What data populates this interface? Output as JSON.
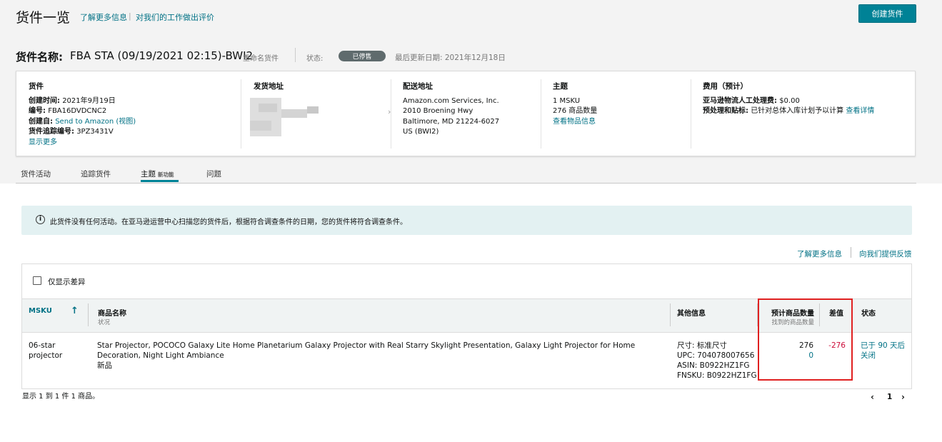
{
  "header": {
    "title": "货件一览",
    "learn_more": "了解更多信息",
    "separator": "|",
    "feedback": "对我们的工作做出评价",
    "create_button": "创建货件"
  },
  "shipment": {
    "name_label": "货件名称:",
    "name": "FBA STA (09/19/2021 02:15)-BWI2",
    "rename": "重命名货件",
    "status_label": "状态:",
    "status": "已停售",
    "updated": "最后更新日期:  2021年12月18日"
  },
  "card": {
    "shipment": {
      "heading": "货件",
      "created_label": "创建时间:",
      "created": "2021年9月19日",
      "id_label": "编号:",
      "id": "FBA16DVDCNC2",
      "created_from_label": "创建自:",
      "created_from": "Send to Amazon",
      "view": "(视图)",
      "tracking_label": "货件追踪编号:",
      "tracking": "3PZ3431V",
      "show_more": "显示更多"
    },
    "ship_from": {
      "heading": "发货地址"
    },
    "ship_to": {
      "heading": "配送地址",
      "lines": [
        "Amazon.com Services, Inc.",
        "2010 Broening Hwy",
        "Baltimore, MD 21224-6027",
        "US (BWI2)"
      ]
    },
    "contents": {
      "heading": "主题",
      "msku": "1 MSKU",
      "units": "276 商品数量",
      "view_items": "查看物品信息"
    },
    "fees": {
      "heading": "费用（预计）",
      "labor_label": "亚马逊物流人工处理费:",
      "labor": "$0.00",
      "prep_label": "预处理和贴标:",
      "prep": "已针对总体入库计划予以计算",
      "details": "查看详情"
    }
  },
  "tabs": [
    {
      "label": "货件活动"
    },
    {
      "label": "追踪货件"
    },
    {
      "label": "主题",
      "badge": "新功能"
    },
    {
      "label": "问题"
    }
  ],
  "alert": {
    "icon": "i",
    "text": "此货件没有任何活动。在亚马逊运营中心扫描您的货件后，根据符合调查条件的日期，您的货件将符合调查条件。"
  },
  "links": {
    "learn_more": "了解更多信息",
    "feedback": "向我们提供反馈"
  },
  "filter": {
    "label": "仅显示差异"
  },
  "table": {
    "columns": {
      "msku": "MSKU",
      "product": "商品名称",
      "product_sub": "状况",
      "info": "其他信息",
      "expected": "预计商品数量",
      "expected_sub": "找到的商品数量",
      "diff": "差值",
      "status": "状态"
    },
    "rows": [
      {
        "msku_line1": "06-star",
        "msku_line2": "projector",
        "title": "Star Projector, POCOCO Galaxy Lite Home Planetarium Galaxy Projector with Real Starry Skylight Presentation, Galaxy Light Projector for Home Decoration, Night Light Ambiance",
        "condition": "新品",
        "size": "尺寸: 标准尺寸",
        "upc": "UPC: 704078007656",
        "asin": "ASIN: B0922HZ1FG",
        "fnsku": "FNSKU: B0922HZ1FG",
        "expected": "276",
        "found": "0",
        "diff": "-276",
        "status_line1": "已于 90 天后",
        "status_line2": "关闭"
      }
    ]
  },
  "footer": {
    "showing": "显示 1 到 1 件 1 商品。",
    "page": "1"
  },
  "icons": {
    "sort": "arrow-up-icon",
    "pager_prev": "chevron-left-icon",
    "pager_next": "chevron-right-icon",
    "card_arrow": "chevron-right-icon"
  },
  "colors": {
    "accent": "#008296",
    "link": "#007185",
    "negative": "#cc0c39",
    "status_pill": "#5f6b6d",
    "highlight": "#e02020"
  }
}
